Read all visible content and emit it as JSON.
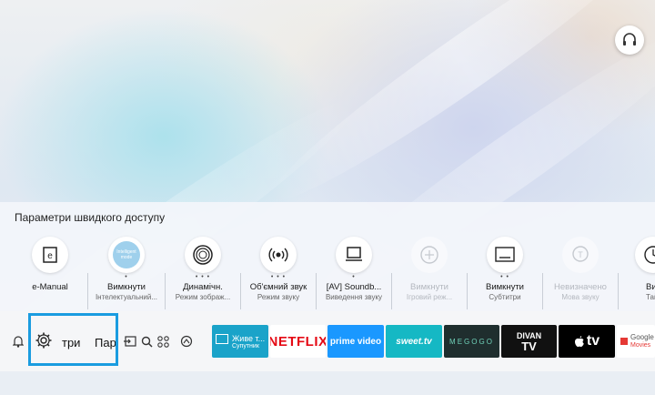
{
  "quick_settings": {
    "title": "Параметри швидкого доступу",
    "items": [
      {
        "label": "e-Manual",
        "sub": "",
        "icon": "manual-icon",
        "dim": false,
        "dots": ""
      },
      {
        "label": "Вимкнути",
        "sub": "Інтелектуальний...",
        "icon": "intelligent-mode-icon",
        "dim": false,
        "dots": "•"
      },
      {
        "label": "Динамічн.",
        "sub": "Режим зображ...",
        "icon": "picture-mode-icon",
        "dim": false,
        "dots": "• • •"
      },
      {
        "label": "Об'ємний звук",
        "sub": "Режим звуку",
        "icon": "sound-mode-icon",
        "dim": false,
        "dots": "• • •"
      },
      {
        "label": "[AV] Soundb...",
        "sub": "Виведення звуку",
        "icon": "sound-output-icon",
        "dim": false,
        "dots": "•"
      },
      {
        "label": "Вимкнути",
        "sub": "Ігровий реж...",
        "icon": "game-mode-icon",
        "dim": true,
        "dots": ""
      },
      {
        "label": "Вимкнути",
        "sub": "Субтитри",
        "icon": "subtitles-icon",
        "dim": false,
        "dots": "• •"
      },
      {
        "label": "Невизначено",
        "sub": "Мова звуку",
        "icon": "audio-language-icon",
        "dim": true,
        "dots": ""
      },
      {
        "label": "Ви",
        "sub": "Тайм",
        "icon": "timer-icon",
        "dim": false,
        "dots": ""
      }
    ],
    "intelligent_icon_text": "Intelligent mode"
  },
  "bottom_bar": {
    "settings_label": "три",
    "next_label": "Пар",
    "apps": [
      {
        "name": "Живе т...",
        "sub": "Супутник",
        "bg": "#1aa3c9"
      },
      {
        "name": "NETFLIX",
        "bg": "#ffffff",
        "fg": "#e50914"
      },
      {
        "name": "prime video",
        "bg": "#1a98ff"
      },
      {
        "name": "sweet.tv",
        "bg": "#15b8c4"
      },
      {
        "name": "MEGOGO",
        "bg": "#1f2e2e"
      },
      {
        "name": "DIVAN",
        "sub": "TV",
        "bg": "#111111"
      },
      {
        "name": "tv",
        "bg": "#000000"
      },
      {
        "name": "Google",
        "sub": "Movies",
        "bg": "#ffffff"
      }
    ]
  }
}
